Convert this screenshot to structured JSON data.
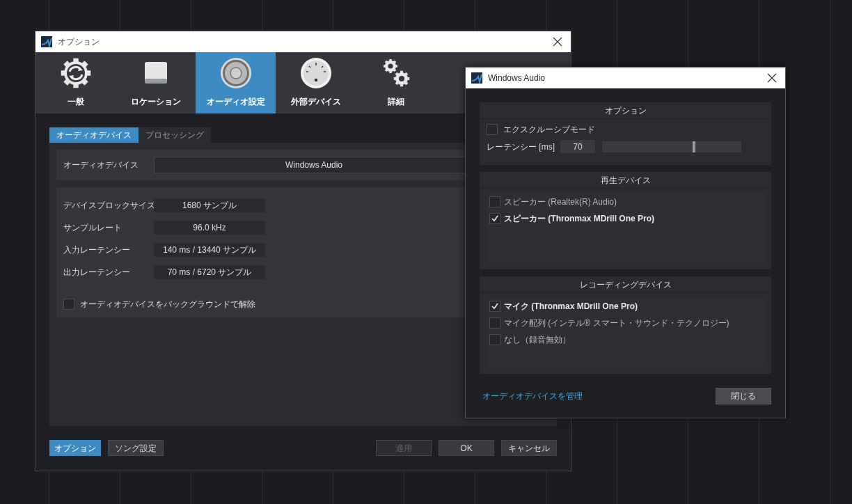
{
  "options_window": {
    "title": "オプション",
    "categories": [
      {
        "label": "一般",
        "selected": false
      },
      {
        "label": "ロケーション",
        "selected": false
      },
      {
        "label": "オーディオ設定",
        "selected": true
      },
      {
        "label": "外部デバイス",
        "selected": false
      },
      {
        "label": "詳細",
        "selected": false
      }
    ],
    "subtabs": [
      {
        "label": "オーディオデバイス",
        "selected": true
      },
      {
        "label": "プロセッシング",
        "selected": false
      }
    ],
    "audio_device": {
      "label": "オーディオデバイス",
      "value": "Windows Audio"
    },
    "info_rows": [
      {
        "label": "デバイスブロックサイズ",
        "value": "1680 サンプル"
      },
      {
        "label": "サンプルレート",
        "value": "96.0 kHz"
      },
      {
        "label": "入力レーテンシー",
        "value": "140 ms / 13440 サンプル"
      },
      {
        "label": "出力レーテンシー",
        "value": "70 ms / 6720 サンプル"
      }
    ],
    "release_in_background": {
      "label": "オーディオデバイスをバックグラウンドで解除",
      "checked": false
    },
    "footer_left": [
      {
        "label": "オプション",
        "selected": true
      },
      {
        "label": "ソング設定",
        "selected": false
      }
    ],
    "footer_right": [
      {
        "label": "適用",
        "disabled": true
      },
      {
        "label": "OK",
        "disabled": false
      },
      {
        "label": "キャンセル",
        "disabled": false
      }
    ]
  },
  "audio_dialog": {
    "title": "Windows Audio",
    "options": {
      "heading": "オプション",
      "exclusive_mode": {
        "label": "エクスクルーシブモード",
        "checked": false
      },
      "latency": {
        "label": "レーテンシー [ms]",
        "value": "70",
        "level": 0.66
      }
    },
    "playback": {
      "heading": "再生デバイス",
      "devices": [
        {
          "label": "スピーカー (Realtek(R) Audio)",
          "checked": false
        },
        {
          "label": "スピーカー (Thronmax MDrill One Pro)",
          "checked": true
        }
      ]
    },
    "recording": {
      "heading": "レコーディングデバイス",
      "devices": [
        {
          "label": "マイク (Thronmax MDrill One Pro)",
          "checked": true
        },
        {
          "label": "マイク配列 (インテル® スマート・サウンド・テクノロジー)",
          "checked": false
        },
        {
          "label": "なし（録音無効）",
          "checked": false
        }
      ]
    },
    "manage_link": "オーディオデバイスを管理",
    "close_button": "閉じる"
  }
}
